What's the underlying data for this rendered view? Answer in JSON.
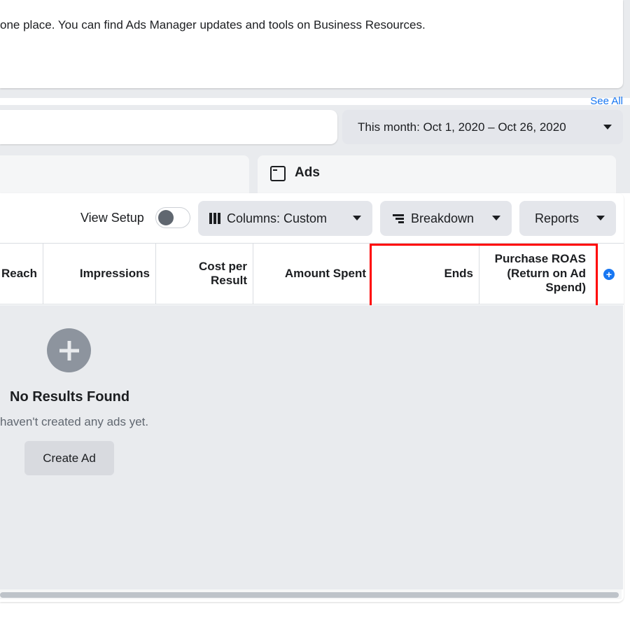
{
  "notice": {
    "text": "one place. You can find Ads Manager updates and tools on Business Resources."
  },
  "see_all": "See All",
  "date_range": {
    "label": "This month: Oct 1, 2020 – Oct 26, 2020"
  },
  "tabs": {
    "ads": {
      "label": "Ads",
      "icon": "ad-frame-icon"
    }
  },
  "toolbar": {
    "view_setup_label": "View Setup",
    "view_setup_on": false,
    "columns_label": "Columns: Custom",
    "breakdown_label": "Breakdown",
    "reports_label": "Reports"
  },
  "table": {
    "columns": [
      {
        "key": "reach",
        "label": "Reach"
      },
      {
        "key": "impressions",
        "label": "Impressions"
      },
      {
        "key": "cost_per_result",
        "label": "Cost per Result"
      },
      {
        "key": "amount_spent",
        "label": "Amount Spent"
      },
      {
        "key": "ends",
        "label": "Ends"
      },
      {
        "key": "purchase_roas",
        "label": "Purchase ROAS (Return on Ad Spend)"
      }
    ],
    "highlighted_columns": [
      "Ends",
      "Purchase ROAS (Return on Ad Spend)"
    ],
    "highlight_color": "#ff0000"
  },
  "empty_state": {
    "title": "No Results Found",
    "subtitle": "haven't created any ads yet.",
    "button_label": "Create Ad"
  },
  "colors": {
    "accent": "#1877f2",
    "panel_bg": "#e9ebee",
    "button_bg": "#e4e6eb"
  }
}
